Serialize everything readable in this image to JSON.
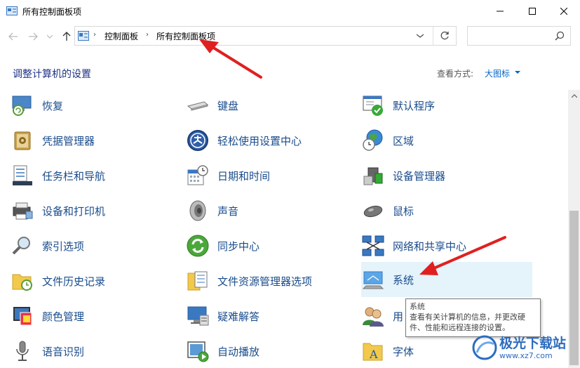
{
  "window": {
    "title": "所有控制面板项"
  },
  "address": {
    "crumbs": [
      "控制面板",
      "所有控制面板项"
    ]
  },
  "search": {
    "placeholder": ""
  },
  "header": {
    "title": "调整计算机的设置",
    "view_by_label": "查看方式:",
    "view_by_value": "大图标"
  },
  "items": {
    "col1": [
      "恢复",
      "凭据管理器",
      "任务栏和导航",
      "设备和打印机",
      "索引选项",
      "文件历史记录",
      "颜色管理",
      "语音识别"
    ],
    "col2": [
      "键盘",
      "轻松使用设置中心",
      "日期和时间",
      "声音",
      "同步中心",
      "文件资源管理器选项",
      "疑难解答",
      "自动播放"
    ],
    "col3": [
      "默认程序",
      "区域",
      "设备管理器",
      "鼠标",
      "网络和共享中心",
      "系统",
      "用",
      "字体"
    ]
  },
  "tooltip": {
    "title": "系统",
    "line1": "查看有关计算机的信息，并更改硬",
    "line2": "件、性能和远程连接的设置。"
  },
  "watermark": {
    "name": "极光下载站",
    "url": "www.xz7.com"
  },
  "colors": {
    "link": "#1a4c8c",
    "title": "#1e3287",
    "arrow": "#e02020",
    "highlight": "#e5f3fb"
  }
}
